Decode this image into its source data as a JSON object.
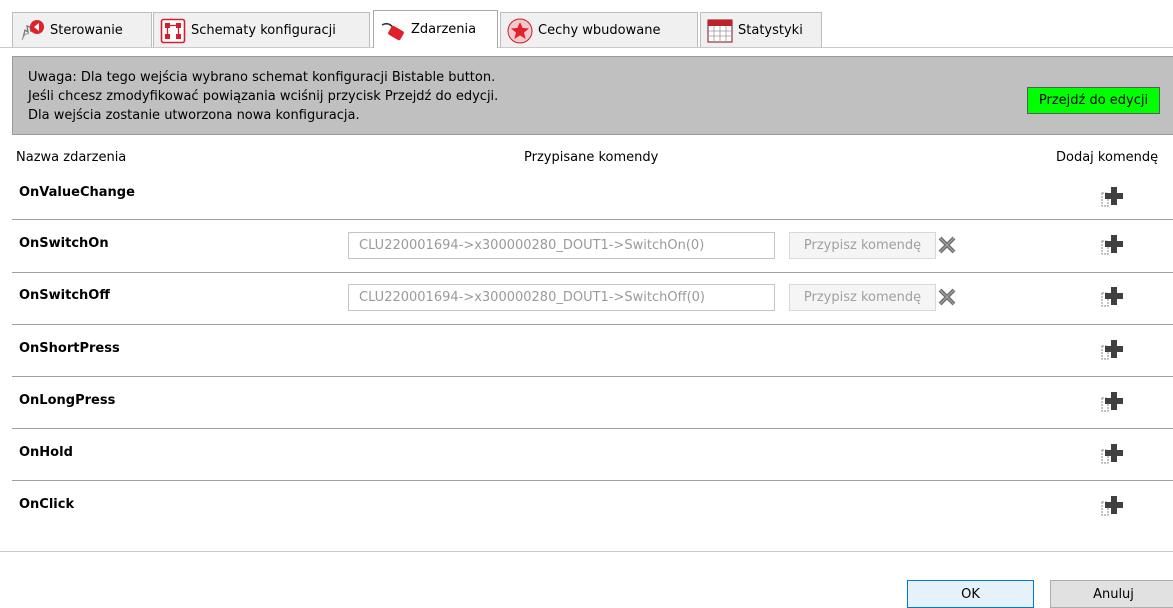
{
  "tabs": [
    {
      "label": "Sterowanie",
      "icon": "hand-pointer-icon"
    },
    {
      "label": "Schematy konfiguracji",
      "icon": "schema-icon"
    },
    {
      "label": "Zdarzenia",
      "icon": "events-icon"
    },
    {
      "label": "Cechy wbudowane",
      "icon": "star-icon"
    },
    {
      "label": "Statystyki",
      "icon": "calendar-table-icon"
    }
  ],
  "active_tab": "Zdarzenia",
  "warning": {
    "line1": "Uwaga: Dla tego wejścia wybrano schemat konfiguracji Bistable button.",
    "line2": "Jeśli chcesz zmodyfikować powiązania wciśnij przycisk Przejdź do edycji.",
    "line3": "Dla wejścia zostanie utworzona nowa konfiguracja.",
    "button_label": "Przejdź do edycji"
  },
  "headers": {
    "event_name": "Nazwa zdarzenia",
    "assigned_commands": "Przypisane komendy",
    "add_command": "Dodaj komendę"
  },
  "events": [
    {
      "name": "OnValueChange"
    },
    {
      "name": "OnSwitchOn",
      "command": "CLU220001694->x300000280_DOUT1->SwitchOn(0)",
      "assign_label": "Przypisz komendę"
    },
    {
      "name": "OnSwitchOff",
      "command": "CLU220001694->x300000280_DOUT1->SwitchOff(0)",
      "assign_label": "Przypisz komendę"
    },
    {
      "name": "OnShortPress"
    },
    {
      "name": "OnLongPress"
    },
    {
      "name": "OnHold"
    },
    {
      "name": "OnClick"
    }
  ],
  "footer": {
    "ok_label": "OK",
    "cancel_label": "Anuluj"
  },
  "colors": {
    "edit_button_bg": "#00ff00",
    "warning_bg": "#c0c0c0",
    "ok_border": "#0078d7"
  }
}
